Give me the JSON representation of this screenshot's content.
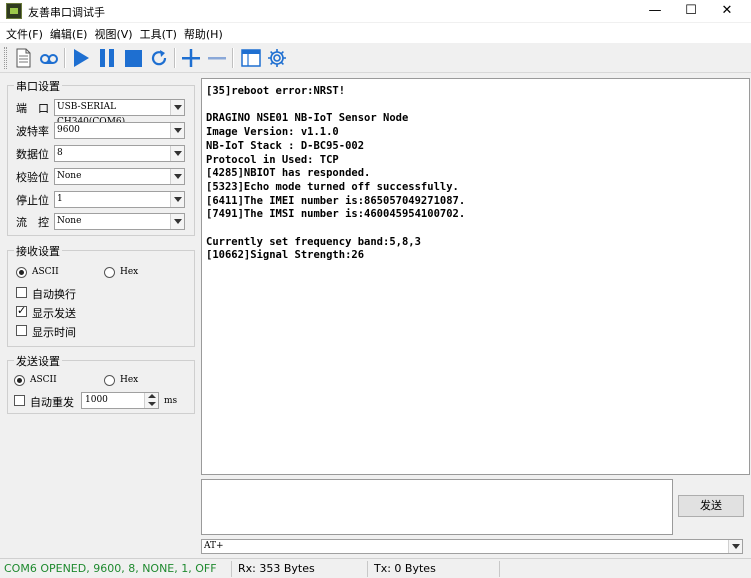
{
  "window": {
    "title": "友善串口调试手",
    "minimize": "—",
    "maximize": "☐",
    "close": "✕"
  },
  "menu": [
    {
      "label": "文件(F)"
    },
    {
      "label": "编辑(E)"
    },
    {
      "label": "视图(V)"
    },
    {
      "label": "工具(T)"
    },
    {
      "label": "帮助(H)"
    }
  ],
  "toolbar": {
    "icons": [
      "new-file-icon",
      "loop-icon",
      "play-icon",
      "pause-icon",
      "stop-icon",
      "refresh-icon",
      "plus-icon",
      "minus-icon",
      "window-icon",
      "gear-icon"
    ],
    "accent": "#1e6fd1"
  },
  "serial": {
    "title": "串口设置",
    "port_label": "端　口",
    "port_value": "USB-SERIAL CH340(COM6)",
    "baud_label": "波特率",
    "baud_value": "9600",
    "databits_label": "数据位",
    "databits_value": "8",
    "parity_label": "校验位",
    "parity_value": "None",
    "stopbits_label": "停止位",
    "stopbits_value": "1",
    "flow_label": "流　控",
    "flow_value": "None"
  },
  "receive": {
    "title": "接收设置",
    "ascii": "ASCII",
    "hex": "Hex",
    "wrap": "自动换行",
    "show_send": "显示发送",
    "show_time": "显示时间"
  },
  "send": {
    "title": "发送设置",
    "ascii": "ASCII",
    "hex": "Hex",
    "auto_resend": "自动重发",
    "interval": "1000",
    "unit": "ms",
    "button": "发送",
    "command": "AT+"
  },
  "output": {
    "text": "[35]reboot error:NRST!\n\nDRAGINO NSE01 NB-IoT Sensor Node\nImage Version: v1.1.0\nNB-IoT Stack : D-BC95-002\nProtocol in Used: TCP\n[4285]NBIOT has responded.\n[5323]Echo mode turned off successfully.\n[6411]The IMEI number is:865057049271087.\n[7491]The IMSI number is:460045954100702.\n\nCurrently set frequency band:5,8,3\n[10662]Signal Strength:26"
  },
  "status": {
    "com": "COM6 OPENED, 9600, 8, NONE, 1, OFF",
    "rx": "Rx: 353 Bytes",
    "tx": "Tx: 0 Bytes",
    "com_color": "#1f8a2f"
  }
}
